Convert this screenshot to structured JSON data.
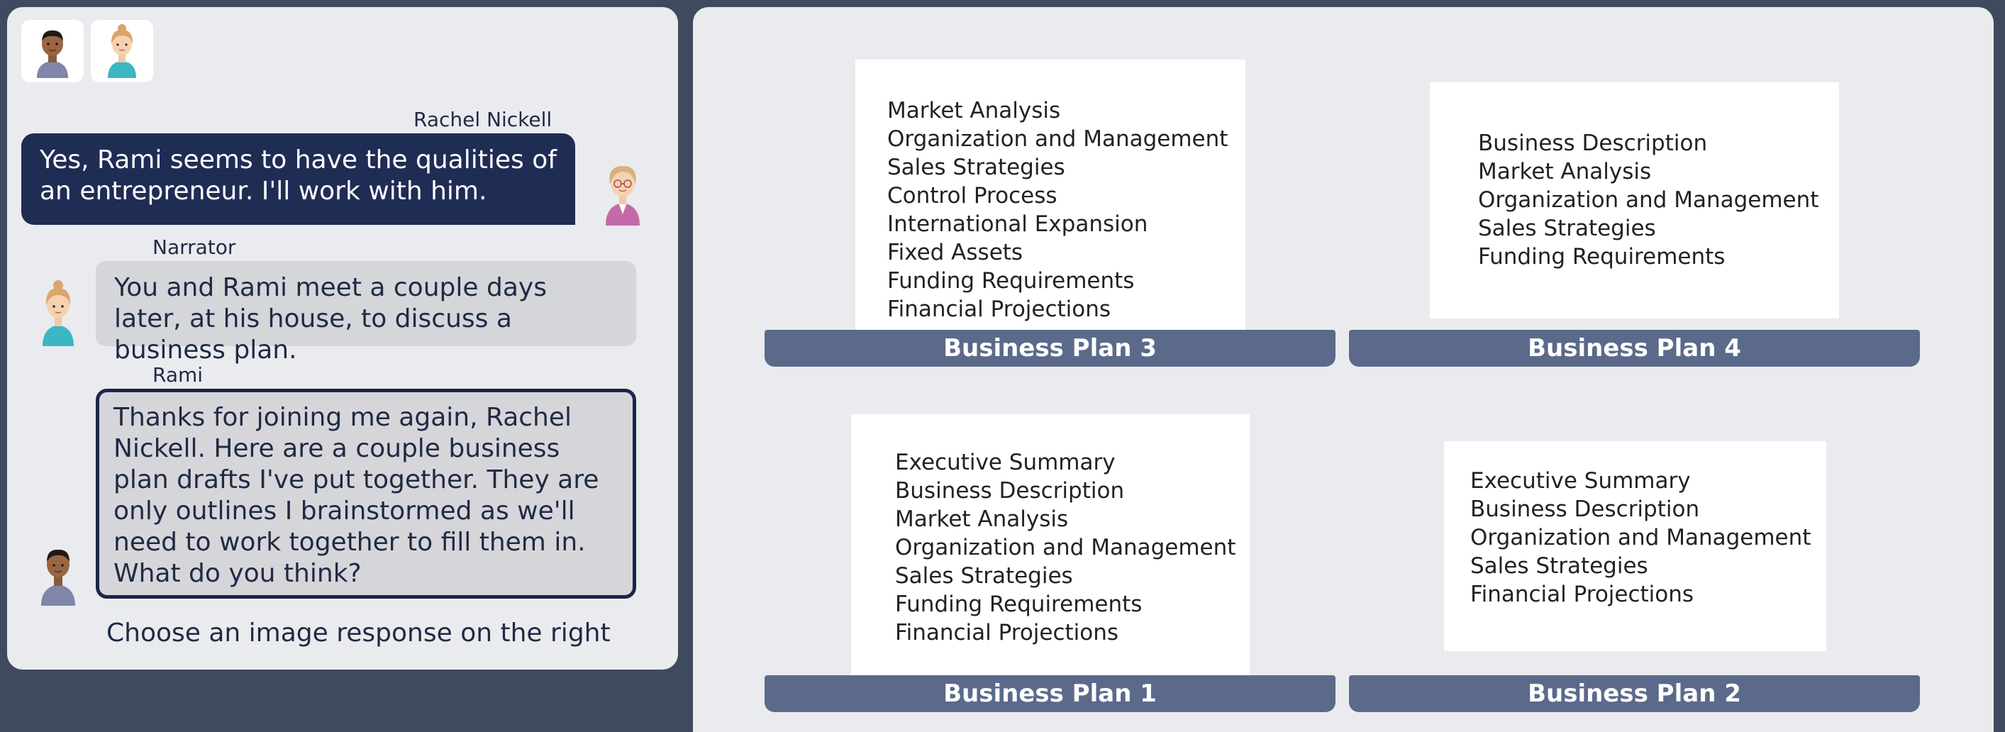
{
  "header": {
    "avatars": [
      {
        "name": "Rami",
        "icon": "male-avatar-icon"
      },
      {
        "name": "Narrator",
        "icon": "female-avatar-icon"
      }
    ]
  },
  "chat": {
    "messages": [
      {
        "speaker": "Rachel Nickell",
        "text": "Yes, Rami seems to have the qualities of an entrepreneur. I'll work with him."
      },
      {
        "speaker": "Narrator",
        "text": "You and Rami meet a couple days later, at his house, to discuss a business plan."
      },
      {
        "speaker": "Rami",
        "text": "Thanks for joining me again, Rachel Nickell. Here are a couple business plan drafts I've put together. They are only outlines I brainstormed as we'll need to work together to fill them in. What do you think?"
      }
    ],
    "prompt": "Choose an image response on the right"
  },
  "choices": [
    {
      "label": "Business Plan 3",
      "items": [
        "Market Analysis",
        "Organization and Management",
        "Sales Strategies",
        "Control Process",
        "International Expansion",
        "Fixed Assets",
        "Funding Requirements",
        "Financial Projections"
      ]
    },
    {
      "label": "Business Plan 4",
      "items": [
        "Business Description",
        "Market Analysis",
        "Organization and Management",
        "Sales Strategies",
        "Funding Requirements"
      ]
    },
    {
      "label": "Business Plan 1",
      "items": [
        "Executive Summary",
        "Business Description",
        "Market Analysis",
        "Organization and Management",
        "Sales Strategies",
        "Funding Requirements",
        "Financial Projections"
      ]
    },
    {
      "label": "Business Plan 2",
      "items": [
        "Executive Summary",
        "Business Description",
        "Organization and Management",
        "Sales Strategies",
        "Financial Projections"
      ]
    }
  ],
  "colors": {
    "background": "#3f4a5e",
    "panel": "#e9ebee",
    "dark_bubble": "#1f2c54",
    "light_bubble": "#d4d6da",
    "label_bar": "#5b6a8a"
  }
}
